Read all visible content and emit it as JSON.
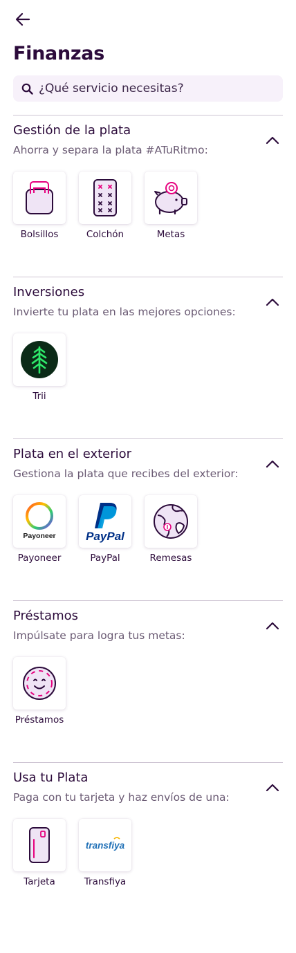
{
  "header": {
    "back_icon": "arrow-left-icon",
    "title": "Finanzas"
  },
  "search": {
    "placeholder": "¿Qué servicio necesitas?",
    "value": "",
    "icon": "search-icon"
  },
  "colors": {
    "primary": "#2c0b3b",
    "accent": "#e6007e",
    "tile_fill": "#efe4f5",
    "trii_bg": "#0b2a17",
    "trii_tree": "#2ee86a",
    "paypal_dark": "#003087",
    "paypal_light": "#009cde",
    "transfiya": "#1e6fb6"
  },
  "sections": [
    {
      "title": "Gestión de la plata",
      "subtitle": "Ahorra y separa la plata #ATuRitmo:",
      "chevron": "chevron-up-icon",
      "items": [
        {
          "label": "Bolsillos",
          "icon": "pocket-icon"
        },
        {
          "label": "Colchón",
          "icon": "mattress-icon"
        },
        {
          "label": "Metas",
          "icon": "piggy-bank-icon"
        }
      ]
    },
    {
      "title": "Inversiones",
      "subtitle": "Invierte tu plata en las mejores opciones:",
      "chevron": "chevron-up-icon",
      "items": [
        {
          "label": "Trii",
          "icon": "trii-logo-icon"
        }
      ]
    },
    {
      "title": "Plata en el exterior",
      "subtitle": "Gestiona la plata que recibes del exterior:",
      "chevron": "chevron-up-icon",
      "items": [
        {
          "label": "Payoneer",
          "icon": "payoneer-logo-icon",
          "logo_text": "Payoneer"
        },
        {
          "label": "PayPal",
          "icon": "paypal-logo-icon",
          "logo_text": "PayPal"
        },
        {
          "label": "Remesas",
          "icon": "globe-icon"
        }
      ]
    },
    {
      "title": "Préstamos",
      "subtitle": "Impúlsate para logra tus metas:",
      "chevron": "chevron-up-icon",
      "items": [
        {
          "label": "Préstamos",
          "icon": "smiley-icon"
        }
      ]
    },
    {
      "title": "Usa tu Plata",
      "subtitle": "Paga con tu tarjeta y haz envíos de una:",
      "chevron": "chevron-up-icon",
      "items": [
        {
          "label": "Tarjeta",
          "icon": "card-icon"
        },
        {
          "label": "Transfiya",
          "icon": "transfiya-logo-icon",
          "logo_text": "transfiya"
        }
      ]
    }
  ]
}
